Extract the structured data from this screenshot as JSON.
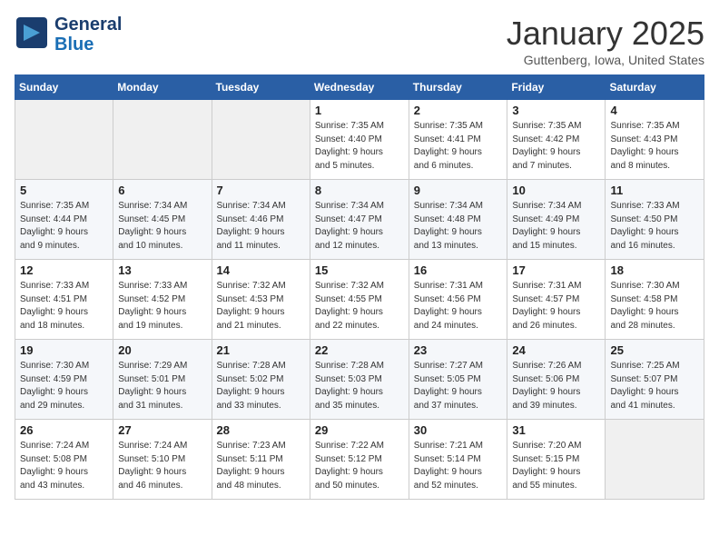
{
  "logo": {
    "line1": "General",
    "line2": "Blue",
    "icon": "▶"
  },
  "title": "January 2025",
  "location": "Guttenberg, Iowa, United States",
  "days_header": [
    "Sunday",
    "Monday",
    "Tuesday",
    "Wednesday",
    "Thursday",
    "Friday",
    "Saturday"
  ],
  "weeks": [
    [
      {
        "day": "",
        "info": ""
      },
      {
        "day": "",
        "info": ""
      },
      {
        "day": "",
        "info": ""
      },
      {
        "day": "1",
        "info": "Sunrise: 7:35 AM\nSunset: 4:40 PM\nDaylight: 9 hours\nand 5 minutes."
      },
      {
        "day": "2",
        "info": "Sunrise: 7:35 AM\nSunset: 4:41 PM\nDaylight: 9 hours\nand 6 minutes."
      },
      {
        "day": "3",
        "info": "Sunrise: 7:35 AM\nSunset: 4:42 PM\nDaylight: 9 hours\nand 7 minutes."
      },
      {
        "day": "4",
        "info": "Sunrise: 7:35 AM\nSunset: 4:43 PM\nDaylight: 9 hours\nand 8 minutes."
      }
    ],
    [
      {
        "day": "5",
        "info": "Sunrise: 7:35 AM\nSunset: 4:44 PM\nDaylight: 9 hours\nand 9 minutes."
      },
      {
        "day": "6",
        "info": "Sunrise: 7:34 AM\nSunset: 4:45 PM\nDaylight: 9 hours\nand 10 minutes."
      },
      {
        "day": "7",
        "info": "Sunrise: 7:34 AM\nSunset: 4:46 PM\nDaylight: 9 hours\nand 11 minutes."
      },
      {
        "day": "8",
        "info": "Sunrise: 7:34 AM\nSunset: 4:47 PM\nDaylight: 9 hours\nand 12 minutes."
      },
      {
        "day": "9",
        "info": "Sunrise: 7:34 AM\nSunset: 4:48 PM\nDaylight: 9 hours\nand 13 minutes."
      },
      {
        "day": "10",
        "info": "Sunrise: 7:34 AM\nSunset: 4:49 PM\nDaylight: 9 hours\nand 15 minutes."
      },
      {
        "day": "11",
        "info": "Sunrise: 7:33 AM\nSunset: 4:50 PM\nDaylight: 9 hours\nand 16 minutes."
      }
    ],
    [
      {
        "day": "12",
        "info": "Sunrise: 7:33 AM\nSunset: 4:51 PM\nDaylight: 9 hours\nand 18 minutes."
      },
      {
        "day": "13",
        "info": "Sunrise: 7:33 AM\nSunset: 4:52 PM\nDaylight: 9 hours\nand 19 minutes."
      },
      {
        "day": "14",
        "info": "Sunrise: 7:32 AM\nSunset: 4:53 PM\nDaylight: 9 hours\nand 21 minutes."
      },
      {
        "day": "15",
        "info": "Sunrise: 7:32 AM\nSunset: 4:55 PM\nDaylight: 9 hours\nand 22 minutes."
      },
      {
        "day": "16",
        "info": "Sunrise: 7:31 AM\nSunset: 4:56 PM\nDaylight: 9 hours\nand 24 minutes."
      },
      {
        "day": "17",
        "info": "Sunrise: 7:31 AM\nSunset: 4:57 PM\nDaylight: 9 hours\nand 26 minutes."
      },
      {
        "day": "18",
        "info": "Sunrise: 7:30 AM\nSunset: 4:58 PM\nDaylight: 9 hours\nand 28 minutes."
      }
    ],
    [
      {
        "day": "19",
        "info": "Sunrise: 7:30 AM\nSunset: 4:59 PM\nDaylight: 9 hours\nand 29 minutes."
      },
      {
        "day": "20",
        "info": "Sunrise: 7:29 AM\nSunset: 5:01 PM\nDaylight: 9 hours\nand 31 minutes."
      },
      {
        "day": "21",
        "info": "Sunrise: 7:28 AM\nSunset: 5:02 PM\nDaylight: 9 hours\nand 33 minutes."
      },
      {
        "day": "22",
        "info": "Sunrise: 7:28 AM\nSunset: 5:03 PM\nDaylight: 9 hours\nand 35 minutes."
      },
      {
        "day": "23",
        "info": "Sunrise: 7:27 AM\nSunset: 5:05 PM\nDaylight: 9 hours\nand 37 minutes."
      },
      {
        "day": "24",
        "info": "Sunrise: 7:26 AM\nSunset: 5:06 PM\nDaylight: 9 hours\nand 39 minutes."
      },
      {
        "day": "25",
        "info": "Sunrise: 7:25 AM\nSunset: 5:07 PM\nDaylight: 9 hours\nand 41 minutes."
      }
    ],
    [
      {
        "day": "26",
        "info": "Sunrise: 7:24 AM\nSunset: 5:08 PM\nDaylight: 9 hours\nand 43 minutes."
      },
      {
        "day": "27",
        "info": "Sunrise: 7:24 AM\nSunset: 5:10 PM\nDaylight: 9 hours\nand 46 minutes."
      },
      {
        "day": "28",
        "info": "Sunrise: 7:23 AM\nSunset: 5:11 PM\nDaylight: 9 hours\nand 48 minutes."
      },
      {
        "day": "29",
        "info": "Sunrise: 7:22 AM\nSunset: 5:12 PM\nDaylight: 9 hours\nand 50 minutes."
      },
      {
        "day": "30",
        "info": "Sunrise: 7:21 AM\nSunset: 5:14 PM\nDaylight: 9 hours\nand 52 minutes."
      },
      {
        "day": "31",
        "info": "Sunrise: 7:20 AM\nSunset: 5:15 PM\nDaylight: 9 hours\nand 55 minutes."
      },
      {
        "day": "",
        "info": ""
      }
    ]
  ]
}
